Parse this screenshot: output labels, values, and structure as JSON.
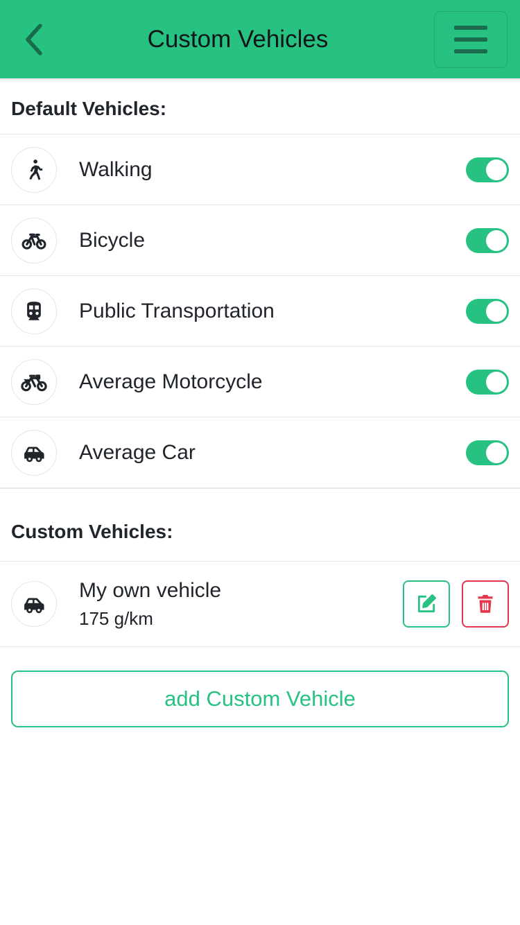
{
  "theme": {
    "accent_green": "#27c281",
    "danger_red": "#e3364c",
    "text_dark": "#20242b",
    "divider": "#e2e4e6"
  },
  "header": {
    "title": "Custom Vehicles",
    "back_icon": "chevron-left-icon",
    "menu_icon": "hamburger-menu-icon"
  },
  "default_section": {
    "title": "Default Vehicles:",
    "items": [
      {
        "label": "Walking",
        "icon": "walking-icon",
        "enabled": true
      },
      {
        "label": "Bicycle",
        "icon": "bicycle-icon",
        "enabled": true
      },
      {
        "label": "Public Transportation",
        "icon": "train-icon",
        "enabled": true
      },
      {
        "label": "Average Motorcycle",
        "icon": "motorcycle-icon",
        "enabled": true
      },
      {
        "label": "Average Car",
        "icon": "car-icon",
        "enabled": true
      }
    ]
  },
  "custom_section": {
    "title": "Custom Vehicles:",
    "items": [
      {
        "name": "My own vehicle",
        "emissions": "175 g/km",
        "icon": "car-icon",
        "edit_icon": "pencil-square-icon",
        "delete_icon": "trash-icon"
      }
    ],
    "add_button_label": "add Custom Vehicle"
  }
}
